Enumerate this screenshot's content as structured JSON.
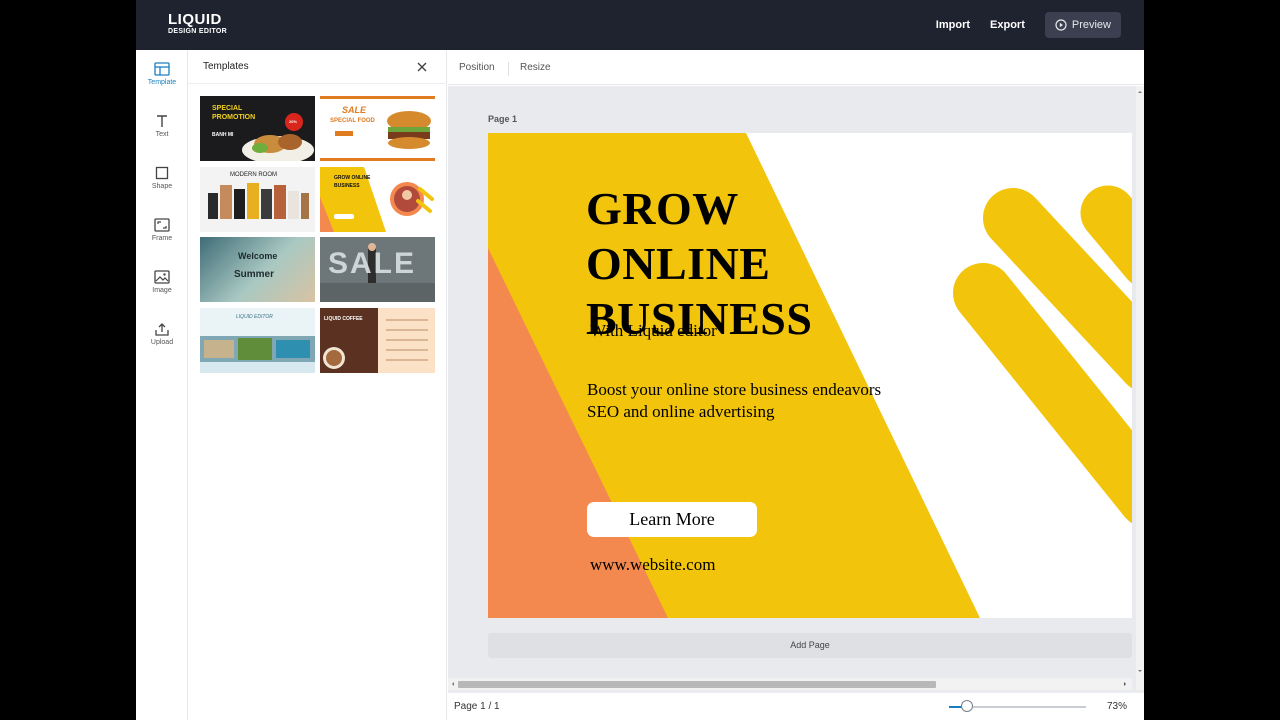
{
  "app": {
    "logo_line1": "LIQUID",
    "logo_line2": "DESIGN EDITOR",
    "import_label": "Import",
    "export_label": "Export",
    "preview_label": "Preview"
  },
  "rail": {
    "items": [
      {
        "label": "Template",
        "icon": "template-icon"
      },
      {
        "label": "Text",
        "icon": "text-icon"
      },
      {
        "label": "Shape",
        "icon": "shape-icon"
      },
      {
        "label": "Frame",
        "icon": "frame-icon"
      },
      {
        "label": "Image",
        "icon": "image-icon"
      },
      {
        "label": "Upload",
        "icon": "upload-icon"
      }
    ]
  },
  "panel": {
    "title": "Templates",
    "thumbnails": [
      {
        "line1": "SPECIAL",
        "line2": "PROMOTION",
        "line3": "BANH MI",
        "badge": "20%"
      },
      {
        "line1": "SALE",
        "line2": "SPECIAL FOOD"
      },
      {
        "line1": "MODERN ROOM"
      },
      {
        "line1": "GROW ONLINE",
        "line2": "BUSINESS"
      },
      {
        "line1": "Welcome",
        "line2": "Summer"
      },
      {
        "line1": "SALE"
      },
      {
        "line1": "LIQUID EDITOR"
      },
      {
        "line1": "LIQUID COFFEE"
      }
    ]
  },
  "toolbar": {
    "position_label": "Position",
    "resize_label": "Resize"
  },
  "canvas": {
    "page_label": "Page 1",
    "title_lines": [
      "GROW",
      "ONLINE",
      "BUSINESS"
    ],
    "subtitle": "With Liquid editor",
    "body_lines": [
      "Boost your online store business endeavors",
      "SEO and online advertising"
    ],
    "button_label": "Learn More",
    "url": "www.website.com",
    "colors": {
      "yellow": "#f2c40c",
      "orange": "#f4894f",
      "white": "#ffffff"
    }
  },
  "workspace": {
    "add_page_label": "Add Page"
  },
  "footer": {
    "page_count": "Page 1 / 1",
    "zoom_level": "73%",
    "zoom_slider_value": 0.13
  }
}
